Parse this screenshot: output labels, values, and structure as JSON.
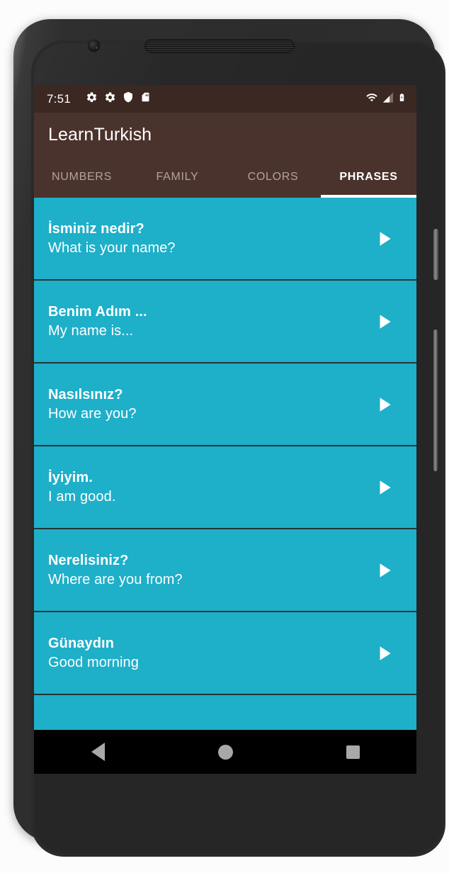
{
  "status_bar": {
    "time": "7:51",
    "left_icons": [
      "gear-icon",
      "gear-icon",
      "shield-icon",
      "sd-card-icon"
    ],
    "right_icons": [
      "wifi-icon",
      "cell-signal-icon",
      "battery-charging-icon"
    ]
  },
  "app_bar": {
    "title": "LearnTurkish"
  },
  "tabs": [
    {
      "label": "NUMBERS",
      "active": false
    },
    {
      "label": "FAMILY",
      "active": false
    },
    {
      "label": "COLORS",
      "active": false
    },
    {
      "label": "PHRASES",
      "active": true
    }
  ],
  "phrases": [
    {
      "native": "İsminiz nedir?",
      "translation": "What is your name?"
    },
    {
      "native": "Benim Adım ...",
      "translation": "My name is..."
    },
    {
      "native": "Nasılsınız?",
      "translation": "How are you?"
    },
    {
      "native": "İyiyim.",
      "translation": "I am good."
    },
    {
      "native": "Nerelisiniz?",
      "translation": "Where are you from?"
    },
    {
      "native": "Günaydın",
      "translation": "Good morning"
    },
    {
      "native": "",
      "translation": ""
    }
  ],
  "nav_bar": {
    "back_label": "back-button",
    "home_label": "home-button",
    "recents_label": "recents-button"
  },
  "colors": {
    "accent": "#1eafc9",
    "app_bar": "#4b332d",
    "status_bar": "#3b2823",
    "divider": "#283437",
    "text_primary": "#ffffff",
    "tab_inactive": "#b3a29d"
  }
}
